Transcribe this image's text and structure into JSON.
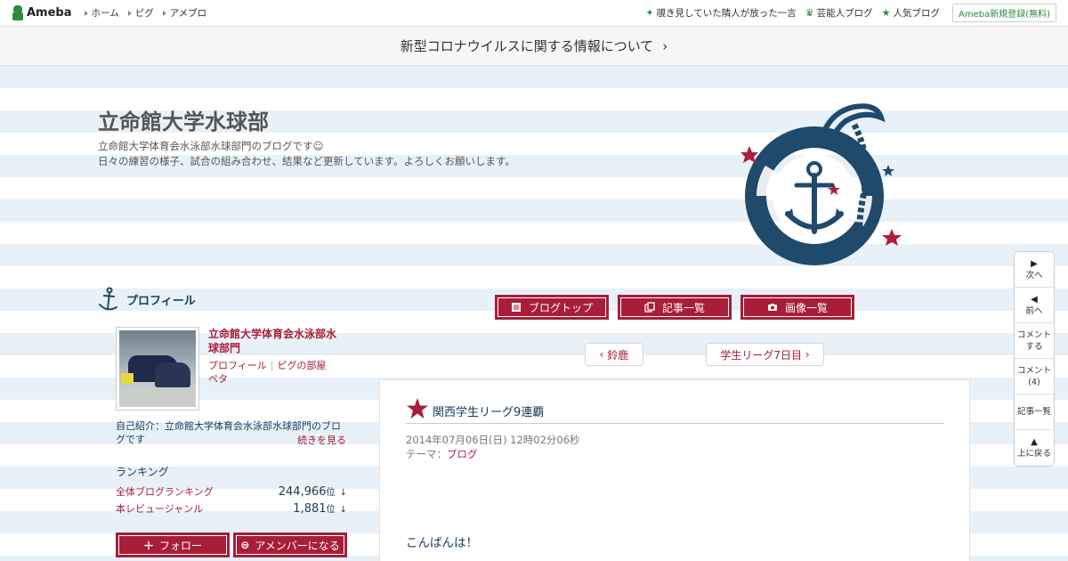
{
  "topbar": {
    "logo_text": "Ameba",
    "nav": [
      "ホーム",
      "ピグ",
      "アメブロ"
    ],
    "right_links": [
      "覗き見していた隣人が放った一言",
      "芸能人ブログ",
      "人気ブログ"
    ],
    "signup": "Ameba新規登録(無料)"
  },
  "notice": {
    "text": "新型コロナウイルスに関する情報について",
    "chevron": "›"
  },
  "blog": {
    "title": "立命館大学水球部",
    "desc_line1": "立命館大学体育会水泳部水球部門のブログです☺",
    "desc_line2": "日々の練習の様子、試合の組み合わせ、結果など更新しています。よろしくお願いします。"
  },
  "profile": {
    "heading": "プロフィール",
    "name": "立命館大学体育会水泳部水球部門",
    "link_profile": "プロフィール",
    "link_room": "ピグの部屋",
    "link_peta": "ペタ",
    "intro": "自己紹介：立命館大学体育会水泳部水球部門のブログです",
    "more": "続きを見る",
    "ranking_title": "ランキング",
    "rankings": [
      {
        "label": "全体ブログランキング",
        "value": "244,966",
        "unit": "位",
        "arrow": "↓"
      },
      {
        "label": "本レビュージャンル",
        "value": "1,881",
        "unit": "位",
        "arrow": "↓"
      }
    ],
    "follow": "フォロー",
    "amember": "アメンバーになる"
  },
  "nav_buttons": [
    "ブログトップ",
    "記事一覧",
    "画像一覧"
  ],
  "pager": {
    "prev": "鈴鹿",
    "next": "学生リーグ7日目"
  },
  "article": {
    "title": "関西学生リーグ9連覇",
    "date": "2014年07月06日(日) 12時02分06秒",
    "theme_label": "テーマ：",
    "theme": "ブログ",
    "body": "こんばんは！"
  },
  "sidetool": [
    {
      "icon": "▶",
      "label": "次へ"
    },
    {
      "icon": "◀",
      "label": "前へ"
    },
    {
      "icon": "",
      "label": "コメント\nする"
    },
    {
      "icon": "",
      "label": "コメント\n(4)"
    },
    {
      "icon": "",
      "label": "記事一覧"
    },
    {
      "icon": "▲",
      "label": "上に戻る"
    }
  ],
  "colors": {
    "accent": "#a81d38",
    "navy": "#1a3a5a",
    "stripe": "#e8f1f8",
    "ameba_green": "#2d8c3c"
  }
}
